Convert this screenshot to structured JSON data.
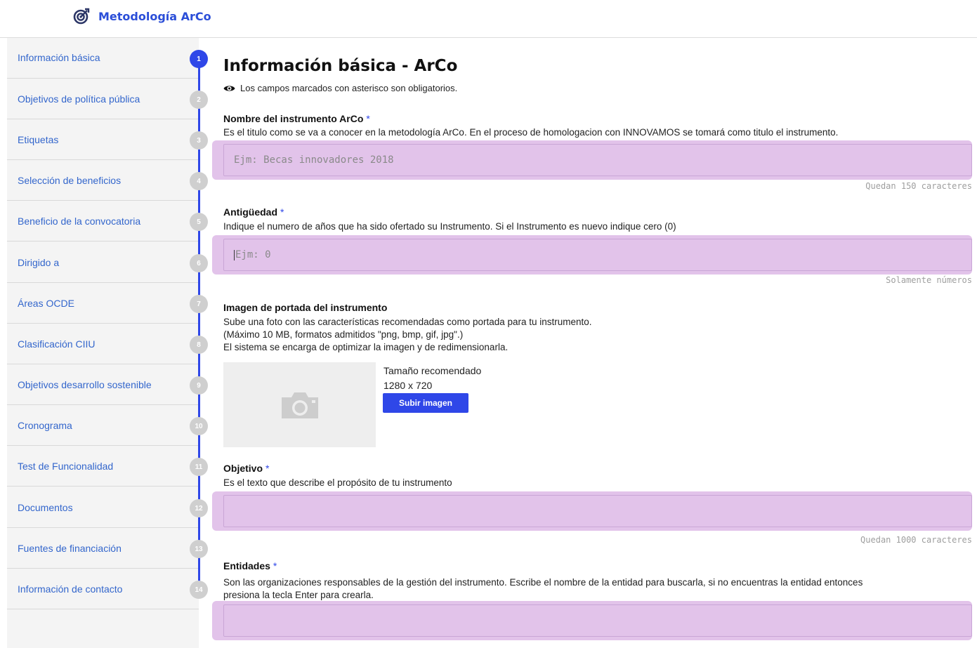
{
  "app": {
    "title": "Metodología ArCo",
    "logo_icon": "target-icon"
  },
  "sidebar": {
    "items": [
      {
        "label": "Información básica",
        "step": "1",
        "active": true
      },
      {
        "label": "Objetivos de política pública",
        "step": "2",
        "active": false
      },
      {
        "label": "Etiquetas",
        "step": "3",
        "active": false
      },
      {
        "label": "Selección de beneficios",
        "step": "4",
        "active": false
      },
      {
        "label": "Beneficio de la convocatoria",
        "step": "5",
        "active": false
      },
      {
        "label": "Dirigido a",
        "step": "6",
        "active": false
      },
      {
        "label": "Áreas OCDE",
        "step": "7",
        "active": false
      },
      {
        "label": "Clasificación CIIU",
        "step": "8",
        "active": false
      },
      {
        "label": "Objetivos desarrollo sostenible",
        "step": "9",
        "active": false
      },
      {
        "label": "Cronograma",
        "step": "10",
        "active": false
      },
      {
        "label": "Test de Funcionalidad",
        "step": "11",
        "active": false
      },
      {
        "label": "Documentos",
        "step": "12",
        "active": false
      },
      {
        "label": "Fuentes de financiación",
        "step": "13",
        "active": false
      },
      {
        "label": "Información de contacto",
        "step": "14",
        "active": false
      }
    ]
  },
  "main": {
    "title": "Información básica - ArCo",
    "required_note": "Los campos marcados con asterisco son obligatorios.",
    "required_mark": "*",
    "nombre": {
      "label": "Nombre del instrumento ArCo",
      "help": "Es el titulo como se va a conocer en la metodología ArCo. En el proceso de homologacion con INNOVAMOS se tomará como titulo el instrumento.",
      "placeholder": "Ejm: Becas innovadores 2018",
      "value": "",
      "counter": "Quedan 150 caracteres"
    },
    "antiguedad": {
      "label": "Antigüedad",
      "help": "Indique el numero de años que ha sido ofertado su Instrumento. Si el Instrumento es nuevo indique cero (0)",
      "placeholder": "Ejm: 0",
      "value": "",
      "counter": "Solamente números"
    },
    "imagen": {
      "label": "Imagen de portada del instrumento",
      "help_lines": [
        "Sube una foto con las características recomendadas como portada para tu instrumento.",
        "(Máximo 10 MB, formatos admitidos \"png, bmp, gif, jpg\".)",
        "El sistema se encarga de optimizar la imagen y de redimensionarla."
      ],
      "recommended_label": "Tamaño recomendado",
      "recommended_size": "1280 x 720",
      "upload_label": "Subir imagen"
    },
    "objetivo": {
      "label": "Objetivo",
      "help": "Es el texto que describe el propósito de tu instrumento",
      "value": "",
      "counter": "Quedan 1000 caracteres"
    },
    "entidades": {
      "label": "Entidades",
      "help_lines": [
        "Son las organizaciones responsables de la gestión del instrumento. Escribe el nombre de la entidad para buscarla, si no encuentras la entidad entonces",
        "presiona la tecla Enter para crearla."
      ],
      "value": ""
    }
  },
  "colors": {
    "accent": "#2f47e8",
    "link": "#3366cc",
    "highlight": "#e2c3ea",
    "step_inactive": "#cfcfcf"
  }
}
